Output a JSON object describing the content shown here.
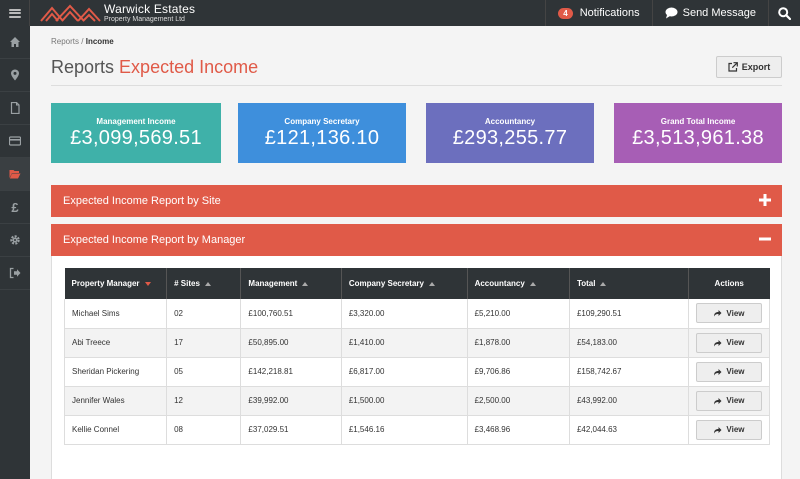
{
  "brand": {
    "title": "Warwick Estates",
    "subtitle": "Property Management Ltd"
  },
  "topbar": {
    "notifications_count": "4",
    "notifications_label": "Notifications",
    "send_message_label": "Send Message"
  },
  "sidebar": {
    "items": [
      {
        "icon": "home-icon"
      },
      {
        "icon": "map-marker-icon"
      },
      {
        "icon": "document-icon"
      },
      {
        "icon": "credit-card-icon"
      },
      {
        "icon": "folder-open-icon",
        "active": true
      },
      {
        "icon": "pound-icon",
        "glyph": "£"
      },
      {
        "icon": "gear-icon"
      },
      {
        "icon": "sign-out-icon"
      }
    ]
  },
  "breadcrumb": {
    "parent": "Reports",
    "separator": "/",
    "current": "Income"
  },
  "page_title": {
    "main": "Reports",
    "accent": "Expected Income"
  },
  "export_label": "Export",
  "stats": [
    {
      "label": "Management Income",
      "value": "£3,099,569.51",
      "color": "#3fb1a9"
    },
    {
      "label": "Company Secretary",
      "value": "£121,136.10",
      "color": "#3e8fdc"
    },
    {
      "label": "Accountancy",
      "value": "£293,255.77",
      "color": "#6c6fbe"
    },
    {
      "label": "Grand Total Income",
      "value": "£3,513,961.38",
      "color": "#a75eb5"
    }
  ],
  "accordions": {
    "by_site": "Expected Income Report by Site",
    "by_manager": "Expected Income Report by Manager"
  },
  "table": {
    "headers": [
      "Property Manager",
      "# Sites",
      "Management",
      "Company Secretary",
      "Accountancy",
      "Total",
      "Actions"
    ],
    "rows": [
      {
        "manager": "Michael Sims",
        "sites": "02",
        "management": "£100,760.51",
        "secretary": "£3,320.00",
        "accountancy": "£5,210.00",
        "total": "£109,290.51",
        "action": "View"
      },
      {
        "manager": "Abi Treece",
        "sites": "17",
        "management": "£50,895.00",
        "secretary": "£1,410.00",
        "accountancy": "£1,878.00",
        "total": "£54,183.00",
        "action": "View"
      },
      {
        "manager": "Sheridan Pickering",
        "sites": "05",
        "management": "£142,218.81",
        "secretary": "£6,817.00",
        "accountancy": "£9,706.86",
        "total": "£158,742.67",
        "action": "View"
      },
      {
        "manager": "Jennifer Wales",
        "sites": "12",
        "management": "£39,992.00",
        "secretary": "£1,500.00",
        "accountancy": "£2,500.00",
        "total": "£43,992.00",
        "action": "View"
      },
      {
        "manager": "Kellie Connel",
        "sites": "08",
        "management": "£37,029.51",
        "secretary": "£1,546.16",
        "accountancy": "£3,468.96",
        "total": "£42,044.63",
        "action": "View"
      }
    ]
  },
  "colors": {
    "accent": "#e05a48",
    "dark": "#2f3437"
  }
}
